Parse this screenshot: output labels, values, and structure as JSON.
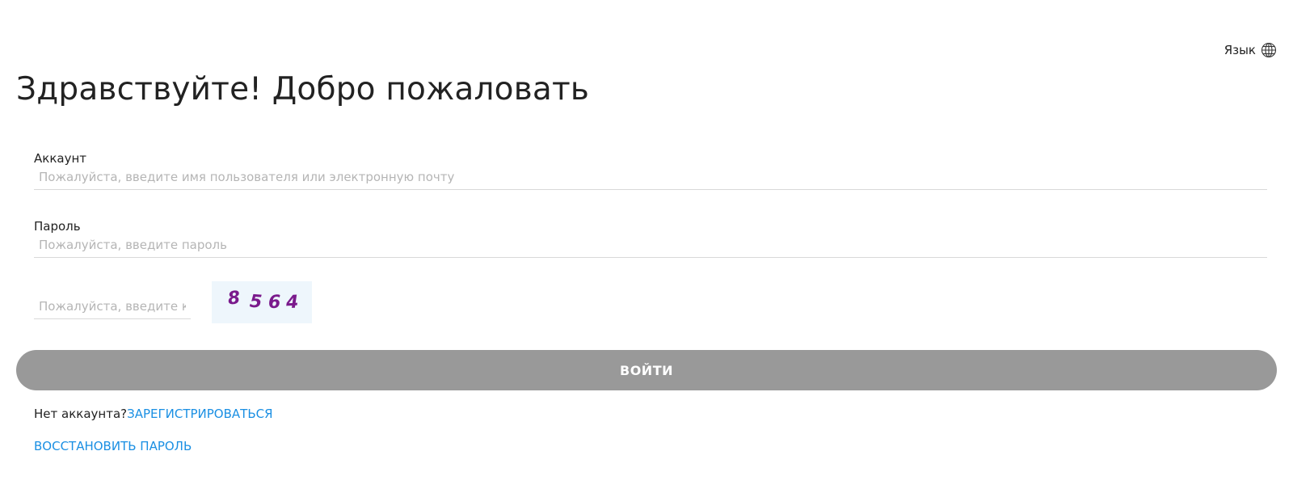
{
  "header": {
    "language_label": "Язык",
    "language_icon": "globe-icon"
  },
  "title": "Здравствуйте! Добро пожаловать",
  "form": {
    "account": {
      "label": "Аккаунт",
      "value": "",
      "placeholder": "Пожалуйста, введите имя пользователя или электронную почту"
    },
    "password": {
      "label": "Пароль",
      "value": "",
      "placeholder": "Пожалуйста, введите пароль"
    },
    "captcha": {
      "value": "",
      "placeholder": "Пожалуйста, введите код",
      "code_digits": [
        "8",
        "5",
        "6",
        "4"
      ],
      "code_color": "#7a1a8c",
      "background_color": "#eef6fc"
    },
    "submit_label": "ВОЙТИ",
    "submit_color": "#999999"
  },
  "footer": {
    "no_account_text": "Нет аккаунта?",
    "register_link": "ЗАРЕГИСТРИРОВАТЬСЯ",
    "restore_link": "ВОССТАНОВИТЬ ПАРОЛЬ",
    "link_color": "#1a8fe3"
  }
}
